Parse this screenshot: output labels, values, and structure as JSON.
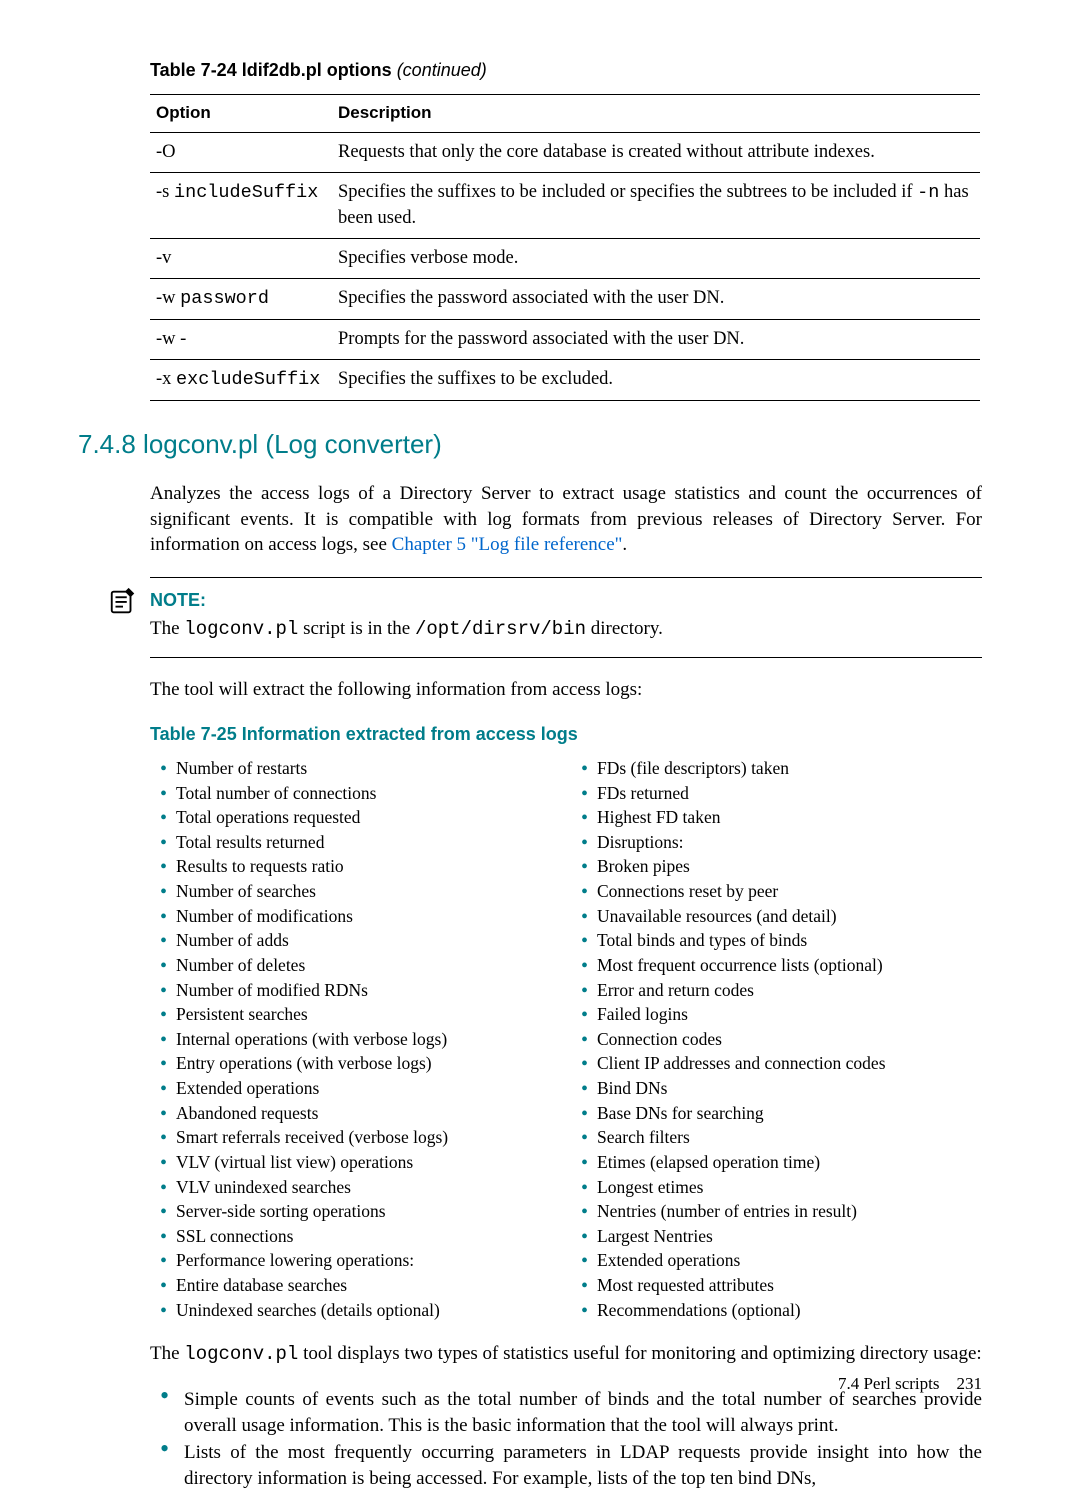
{
  "table24": {
    "caption_prefix": "Table 7-24 ldif2db.pl options",
    "caption_suffix": " (continued)",
    "header_option": "Option",
    "header_description": "Description",
    "rows": [
      {
        "opt_plain": "-O",
        "opt_mono": "",
        "desc_pre": "Requests that only the core database is created without attribute indexes.",
        "desc_mono": "",
        "desc_post": ""
      },
      {
        "opt_plain": "-s ",
        "opt_mono": "includeSuffix",
        "desc_pre": "Specifies the suffixes to be included or specifies the subtrees to be included if ",
        "desc_mono": "-n",
        "desc_post": " has been used."
      },
      {
        "opt_plain": "-v",
        "opt_mono": "",
        "desc_pre": "Specifies verbose mode.",
        "desc_mono": "",
        "desc_post": ""
      },
      {
        "opt_plain": "-w ",
        "opt_mono": "password",
        "desc_pre": "Specifies the password associated with the user DN.",
        "desc_mono": "",
        "desc_post": ""
      },
      {
        "opt_plain": "-w -",
        "opt_mono": "",
        "desc_pre": "Prompts for the password associated with the user DN.",
        "desc_mono": "",
        "desc_post": ""
      },
      {
        "opt_plain": "-x ",
        "opt_mono": "excludeSuffix",
        "desc_pre": "Specifies the suffixes to be excluded.",
        "desc_mono": "",
        "desc_post": ""
      }
    ]
  },
  "section": {
    "heading": "7.4.8 logconv.pl (Log converter)",
    "para1_pre": "Analyzes the access logs of a Directory Server to extract usage statistics and count the occurrences of significant events. It is compatible with log formats from previous releases of Directory Server. For information on access logs, see ",
    "para1_link": "Chapter 5 \"Log file reference\"",
    "para1_post": "."
  },
  "note": {
    "title": "NOTE:",
    "pre": "The ",
    "code1": "logconv.pl",
    "mid": " script is in the ",
    "code2": "/opt/dirsrv/bin",
    "post": " directory."
  },
  "para2": "The tool will extract the following information from access logs:",
  "table25_caption": "Table 7-25 Information extracted from access logs",
  "list_left": [
    "Number of restarts",
    "Total number of connections",
    "Total operations requested",
    "Total results returned",
    "Results to requests ratio",
    "Number of searches",
    "Number of modifications",
    "Number of adds",
    "Number of deletes",
    "Number of modified RDNs",
    "Persistent searches",
    "Internal operations (with verbose logs)",
    "Entry operations (with verbose logs)",
    "Extended operations",
    "Abandoned requests",
    "Smart referrals received (verbose logs)",
    "VLV (virtual list view) operations",
    "VLV unindexed searches",
    "Server-side sorting operations",
    "SSL connections",
    "Performance lowering operations:",
    "Entire database searches",
    "Unindexed searches (details optional)"
  ],
  "list_right": [
    "FDs (file descriptors) taken",
    "FDs returned",
    "Highest FD taken",
    "Disruptions:",
    "Broken pipes",
    "Connections reset by peer",
    "Unavailable resources (and detail)",
    "Total binds and types of binds",
    "Most frequent occurrence lists (optional)",
    "Error and return codes",
    "Failed logins",
    "Connection codes",
    "Client IP addresses and connection codes",
    "Bind DNs",
    "Base DNs for searching",
    "Search filters",
    "Etimes (elapsed operation time)",
    "Longest etimes",
    "Nentries (number of entries in result)",
    "Largest Nentries",
    "Extended operations",
    "Most requested attributes",
    "Recommendations (optional)"
  ],
  "para3_pre": "The ",
  "para3_code": "logconv.pl",
  "para3_post": " tool displays two types of statistics useful for monitoring and optimizing directory usage:",
  "big_bullets": [
    "Simple counts of events such as the total number of binds and the total number of searches provide overall usage information. This is the basic information that the tool will always print.",
    "Lists of the most frequently occurring parameters in LDAP requests provide insight into how the directory information is being accessed. For example, lists of the top ten bind DNs,"
  ],
  "footer": {
    "section": "7.4 Perl scripts",
    "page": "231"
  }
}
